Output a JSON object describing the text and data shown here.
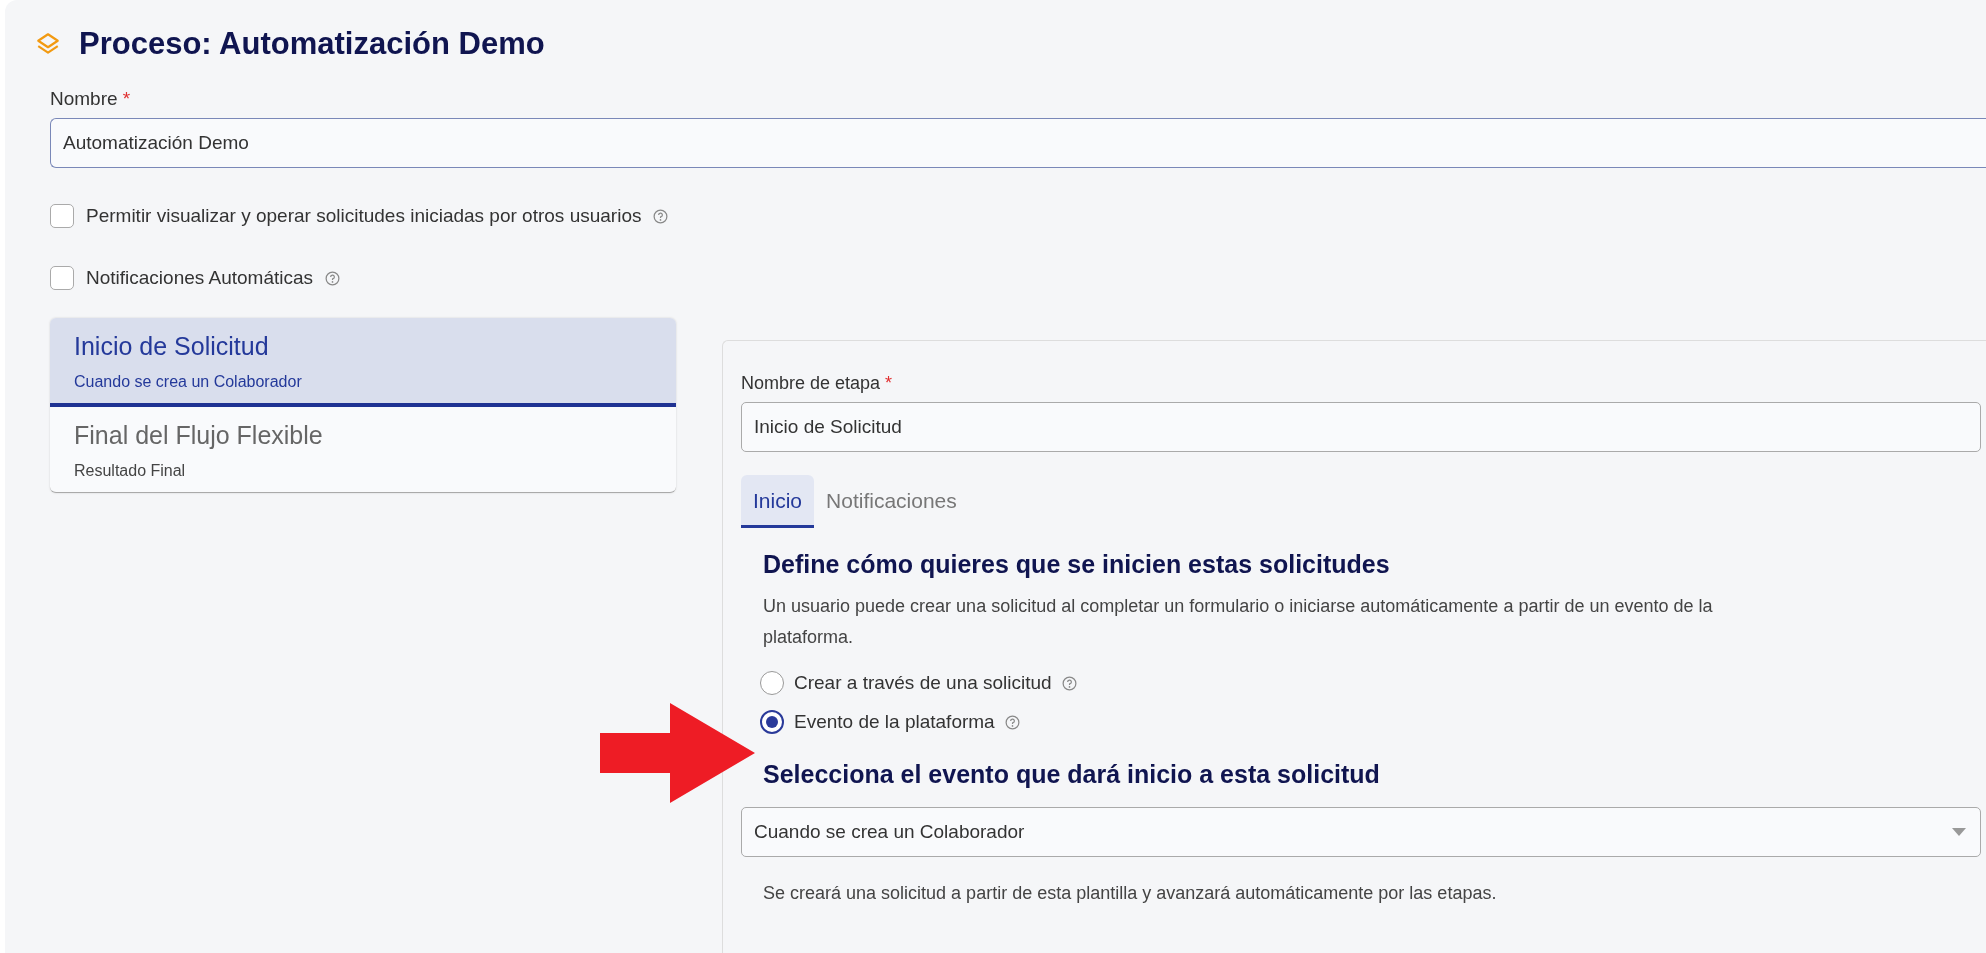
{
  "header": {
    "title": "Proceso: Automatización Demo"
  },
  "name_field": {
    "label": "Nombre",
    "required_mark": "*",
    "value": "Automatización Demo"
  },
  "options": [
    {
      "label": "Permitir visualizar y operar solicitudes iniciadas por otros usuarios",
      "checked": false
    },
    {
      "label": "Notificaciones Automáticas",
      "checked": false
    }
  ],
  "stages": [
    {
      "title": "Inicio de Solicitud",
      "subtitle": "Cuando se crea un Colaborador",
      "selected": true
    },
    {
      "title": "Final del Flujo Flexible",
      "subtitle": "Resultado Final",
      "selected": false
    }
  ],
  "stage_panel": {
    "name_label": "Nombre de etapa",
    "required_mark": "*",
    "name_value": "Inicio de Solicitud",
    "tabs": [
      {
        "label": "Inicio",
        "selected": true
      },
      {
        "label": "Notificaciones",
        "selected": false
      }
    ],
    "heading": "Define cómo quieres que se inicien estas solicitudes",
    "description": "Un usuario puede crear una solicitud al completar un formulario o iniciarse automáticamente a partir de un evento de la plataforma.",
    "start_options": [
      {
        "label": "Crear a través de una solicitud",
        "selected": false
      },
      {
        "label": "Evento de la plataforma",
        "selected": true
      }
    ],
    "event_heading": "Selecciona el evento que dará inicio a esta solicitud",
    "event_value": "Cuando se crea un Colaborador",
    "note": "Se creará una solicitud a partir de esta plantilla y avanzará automáticamente por las etapas."
  },
  "annotation": {
    "kind": "arrow"
  }
}
